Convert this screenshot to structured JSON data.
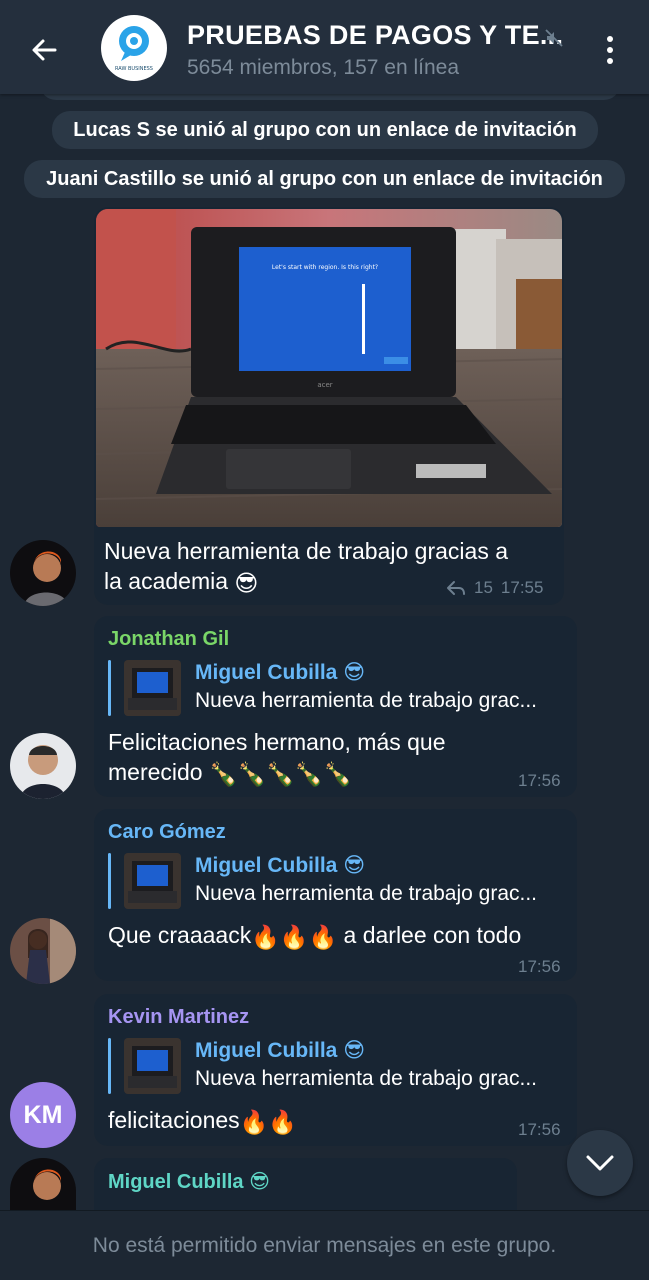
{
  "header": {
    "title": "PRUEBAS DE PAGOS Y TE...",
    "subtitle": "5654 miembros, 157 en línea",
    "logo_text": "RAW BUSINESS"
  },
  "service_messages": [
    "Lucas S se unió al grupo con un enlace de invitación",
    "Juani Castillo se unió al grupo con un enlace de invitación"
  ],
  "photo_message": {
    "text_line1": "Nueva herramienta de trabajo gracias a",
    "text_line2": "la academia",
    "emoji": "😎",
    "reply_count": "15",
    "time": "17:55",
    "screen_text": "Let's start with region. Is this right?",
    "laptop_brand": "acer"
  },
  "messages": [
    {
      "sender": "Jonathan Gil",
      "sender_color": "#7ad668",
      "reply_name": "Miguel Cubilla",
      "reply_emoji": "😎",
      "reply_text": "Nueva herramienta de trabajo grac...",
      "text_line1": "Felicitaciones hermano, más que",
      "text_line2": "merecido",
      "emojis": "🍾🍾🍾🍾🍾",
      "time": "17:56"
    },
    {
      "sender": "Caro Gómez",
      "sender_color": "#67b7f7",
      "reply_name": "Miguel Cubilla",
      "reply_emoji": "😎",
      "reply_text": "Nueva herramienta de trabajo grac...",
      "text": "Que craaaack",
      "emojis": "🔥🔥🔥",
      "text_after": "a darlee con todo",
      "time": "17:56"
    },
    {
      "sender": "Kevin Martinez",
      "sender_color": "#a695f2",
      "reply_name": "Miguel Cubilla",
      "reply_emoji": "😎",
      "reply_text": "Nueva herramienta de trabajo grac...",
      "text": "felicitaciones",
      "emojis": "🔥🔥",
      "time": "17:56",
      "avatar_initials": "KM"
    },
    {
      "sender": "Miguel Cubilla",
      "sender_color": "#5fd6c6",
      "sender_emoji": "😎"
    }
  ],
  "footer": {
    "text": "No está permitido enviar mensajes en este grupo."
  },
  "colors": {
    "background": "#1d2733",
    "header": "#242f3d",
    "bubble": "#182533",
    "accent": "#67b7f7"
  }
}
